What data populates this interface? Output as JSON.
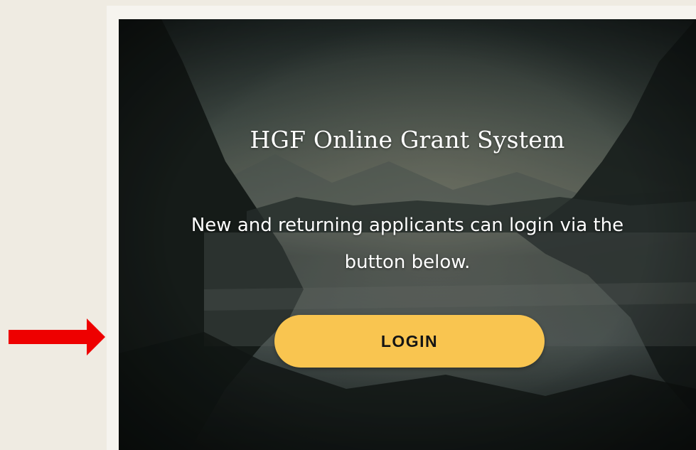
{
  "hero": {
    "title": "HGF Online Grant System",
    "message": "New and returning applicants can login via the button below.",
    "login_label": "LOGIN"
  },
  "colors": {
    "page_background": "#efebe2",
    "button": "#f9c550",
    "button_text": "#141414",
    "arrow": "#ee0000",
    "text": "#ffffff"
  },
  "icons": {
    "arrow": "right-arrow-icon"
  }
}
